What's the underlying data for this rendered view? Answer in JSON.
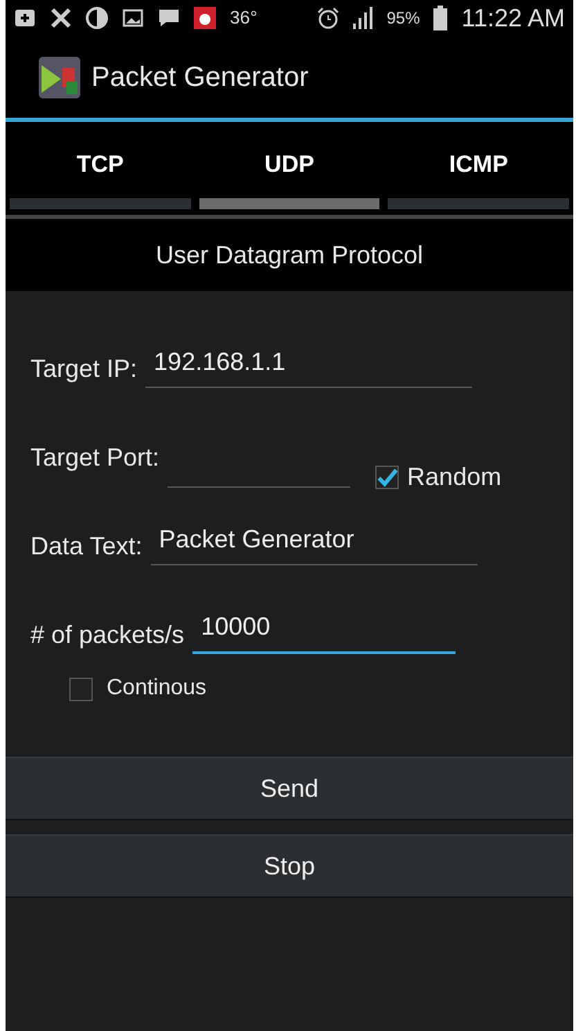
{
  "status_bar": {
    "temperature": "36°",
    "battery_percent": "95%",
    "time": "11:22 AM"
  },
  "app_bar": {
    "title": "Packet Generator"
  },
  "tabs": [
    {
      "label": "TCP",
      "selected": false
    },
    {
      "label": "UDP",
      "selected": true
    },
    {
      "label": "ICMP",
      "selected": false
    }
  ],
  "section_title": "User Datagram Protocol",
  "form": [
    {
      "kind": "field",
      "label": "Target IP:",
      "value": "192.168.1.1",
      "focused": false
    },
    {
      "kind": "port",
      "label": "Target Port:",
      "focused": false,
      "option": {
        "label": "Random",
        "checked": true
      }
    },
    {
      "kind": "field",
      "label": "Data Text:",
      "value": "Packet Generator",
      "focused": false
    },
    {
      "kind": "field",
      "label": "# of packets/s",
      "value": "10000",
      "focused": true
    },
    {
      "kind": "checkbox",
      "label": "Continous",
      "checked": false
    }
  ],
  "buttons": [
    "Send",
    "Stop"
  ]
}
